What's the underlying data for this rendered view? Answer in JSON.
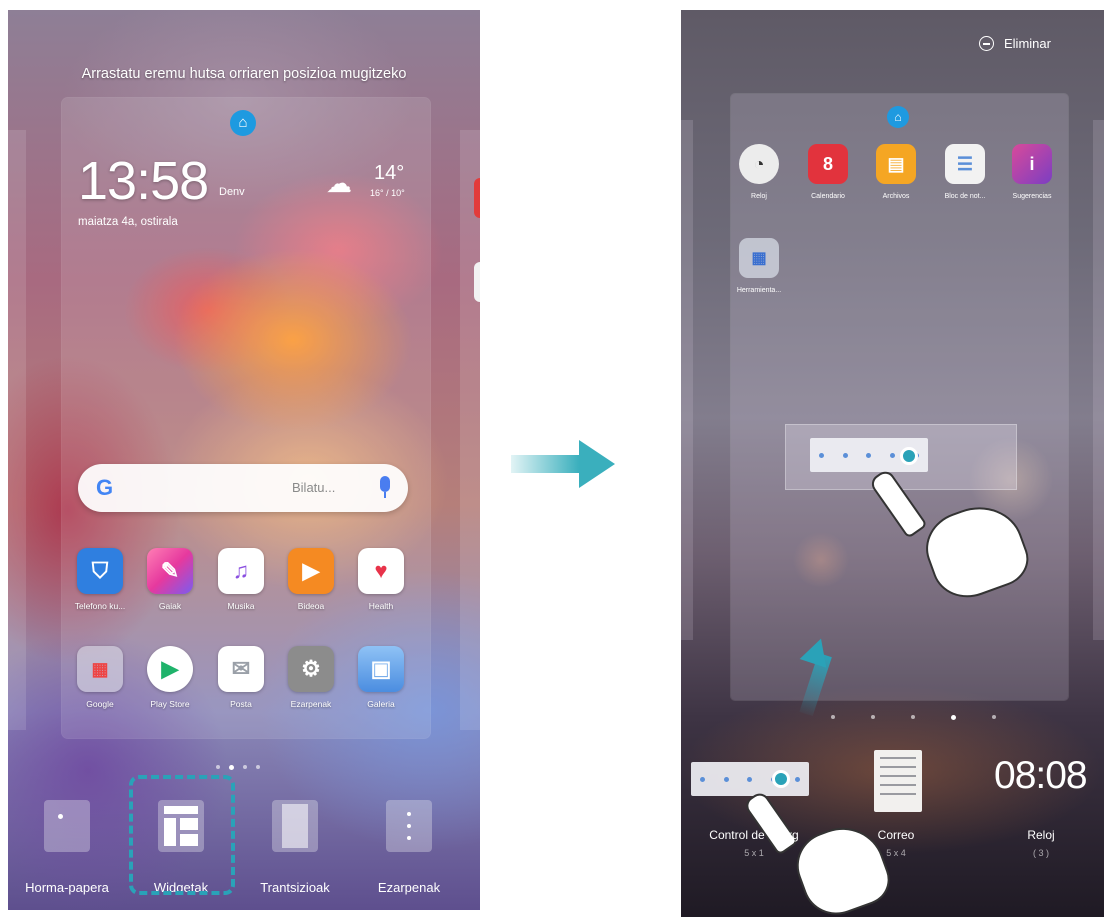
{
  "left_screen": {
    "page_hint": "Arrastatu eremu hutsa orriaren posizioa mugitzeko",
    "clock": {
      "time": "13:58",
      "city": "Denv",
      "date": "maiatza 4a, ostirala"
    },
    "weather": {
      "temp": "14°",
      "range": "16° / 10°"
    },
    "search": {
      "google_letter": "G",
      "placeholder": "Bilatu..."
    },
    "apps_row1": [
      {
        "label": "Telefono ku...",
        "icon": "shield-icon",
        "color": "#2f7fe0",
        "glyph": "⛉"
      },
      {
        "label": "Gaiak",
        "icon": "brush-icon",
        "color": "#e6399e",
        "glyph": "✎"
      },
      {
        "label": "Musika",
        "icon": "music-icon",
        "color": "#8a4fe0",
        "glyph": "♫"
      },
      {
        "label": "Bideoa",
        "icon": "video-icon",
        "color": "#f58a22",
        "glyph": "▶"
      },
      {
        "label": "Health",
        "icon": "heart-icon",
        "color": "#ffffff",
        "glyph": "♥"
      }
    ],
    "apps_row2": [
      {
        "label": "Google",
        "icon": "folder-icon",
        "color": "#9fc6c6",
        "glyph": "▦"
      },
      {
        "label": "Play Store",
        "icon": "play-store-icon",
        "color": "#ffffff",
        "glyph": "▶"
      },
      {
        "label": "Posta",
        "icon": "mail-icon",
        "color": "#ffffff",
        "glyph": "✉"
      },
      {
        "label": "Ezarpenak",
        "icon": "settings-icon",
        "color": "#8c8c8c",
        "glyph": "⚙"
      },
      {
        "label": "Galeria",
        "icon": "gallery-icon",
        "color": "#5e9ee8",
        "glyph": "▣"
      }
    ],
    "dock": [
      {
        "label": "Horma-papera",
        "icon": "wallpaper-icon"
      },
      {
        "label": "Widgetak",
        "icon": "widgets-icon"
      },
      {
        "label": "Trantsizioak",
        "icon": "transitions-icon"
      },
      {
        "label": "Ezarpenak",
        "icon": "settings-icon"
      }
    ]
  },
  "right_screen": {
    "delete_label": "Eliminar",
    "apps": [
      {
        "label": "Reloj",
        "icon": "clock-icon",
        "color": "#e9e9e9",
        "glyph": "◔"
      },
      {
        "label": "Calendario",
        "icon": "calendar-icon",
        "color": "#e2333d",
        "glyph": "8"
      },
      {
        "label": "Archivos",
        "icon": "files-icon",
        "color": "#f5a623",
        "glyph": "▤"
      },
      {
        "label": "Bloc de not...",
        "icon": "notepad-icon",
        "color": "#f2f2f2",
        "glyph": "☰"
      },
      {
        "label": "Sugerencias",
        "icon": "tips-icon",
        "color": "#9c3ec2",
        "glyph": "i"
      }
    ],
    "folder": {
      "label": "Herramienta...",
      "icon": "folder-icon"
    },
    "widgets": [
      {
        "label": "Control de energ",
        "size": "5 x 1"
      },
      {
        "label": "Correo",
        "size": "5 x 4"
      },
      {
        "label": "Reloj",
        "size": "( 3 )"
      }
    ],
    "big_time": "08:08"
  }
}
